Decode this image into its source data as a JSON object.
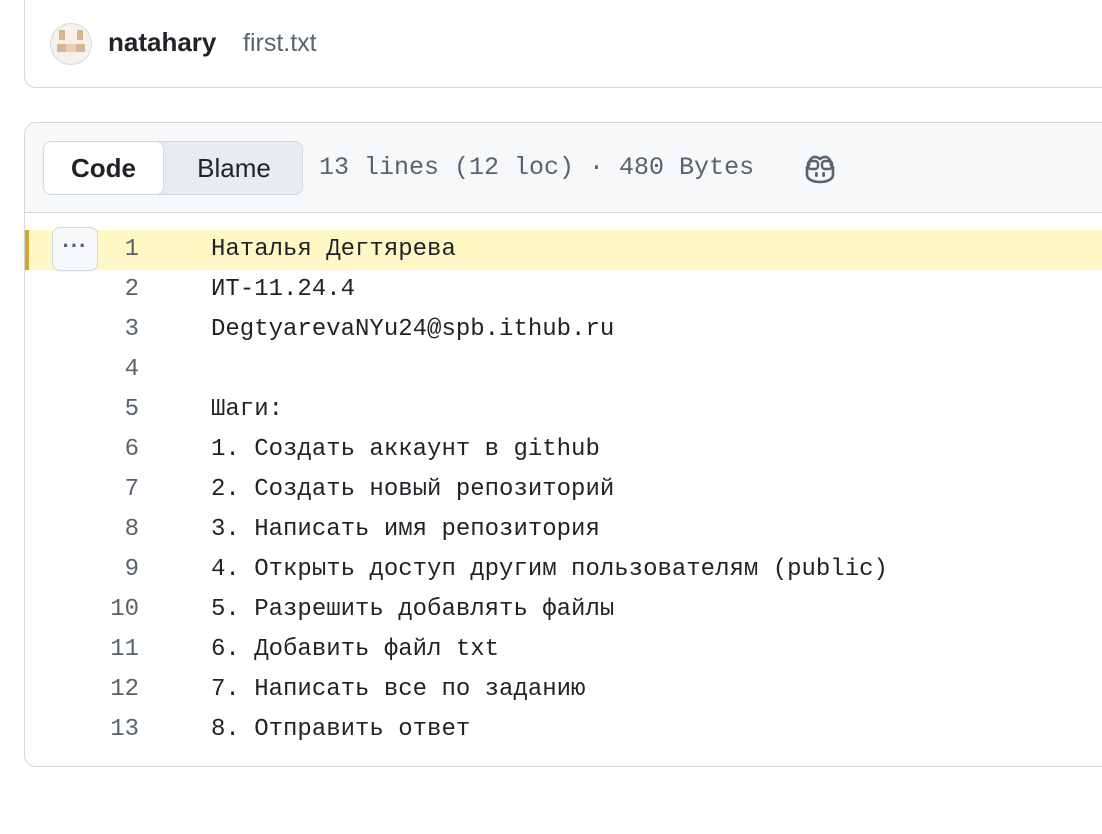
{
  "commit": {
    "author": "natahary",
    "file_name": "first.txt"
  },
  "file_header": {
    "tabs": [
      {
        "label": "Code",
        "selected": true
      },
      {
        "label": "Blame",
        "selected": false
      }
    ],
    "info": "13 lines (12 loc) · 480 Bytes",
    "copilot_icon": "copilot-icon"
  },
  "line_menu_label": "···",
  "lines": [
    {
      "num": "1",
      "text": "Наталья Дегтярева",
      "highlighted": true
    },
    {
      "num": "2",
      "text": "ИТ-11.24.4"
    },
    {
      "num": "3",
      "text": "DegtyarevaNYu24@spb.ithub.ru"
    },
    {
      "num": "4",
      "text": ""
    },
    {
      "num": "5",
      "text": "Шаги:"
    },
    {
      "num": "6",
      "text": "1. Создать аккаунт в github"
    },
    {
      "num": "7",
      "text": "2. Создать новый репозиторий"
    },
    {
      "num": "8",
      "text": "3. Написать имя репозитория"
    },
    {
      "num": "9",
      "text": "4. Открыть доступ другим пользователям (public)"
    },
    {
      "num": "10",
      "text": "5. Разрешить добавлять файлы"
    },
    {
      "num": "11",
      "text": "6. Добавить файл txt"
    },
    {
      "num": "12",
      "text": "7. Написать все по заданию"
    },
    {
      "num": "13",
      "text": "8. Отправить ответ"
    }
  ],
  "colors": {
    "highlight_bg": "#fff8c5",
    "highlight_bar": "#d4a72c",
    "muted_text": "#59636e",
    "border": "#d1d9e0"
  }
}
